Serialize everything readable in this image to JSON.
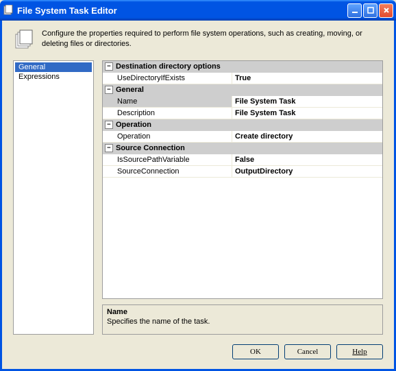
{
  "window": {
    "title": "File System Task Editor",
    "description": "Configure the properties required to perform file system operations, such as creating, moving, or deleting files or directories."
  },
  "sidebar": {
    "items": [
      {
        "label": "General",
        "selected": true
      },
      {
        "label": "Expressions",
        "selected": false
      }
    ]
  },
  "grid": {
    "categories": [
      {
        "label": "Destination directory options",
        "rows": [
          {
            "name": "UseDirectoryIfExists",
            "value": "True"
          }
        ]
      },
      {
        "label": "General",
        "rows": [
          {
            "name": "Name",
            "value": "File System Task",
            "selected": true
          },
          {
            "name": "Description",
            "value": "File System Task"
          }
        ]
      },
      {
        "label": "Operation",
        "rows": [
          {
            "name": "Operation",
            "value": "Create directory"
          }
        ]
      },
      {
        "label": "Source Connection",
        "rows": [
          {
            "name": "IsSourcePathVariable",
            "value": "False"
          },
          {
            "name": "SourceConnection",
            "value": "OutputDirectory"
          }
        ]
      }
    ]
  },
  "help": {
    "title": "Name",
    "description": "Specifies the name of the task."
  },
  "buttons": {
    "ok": "OK",
    "cancel": "Cancel",
    "help": "Help"
  }
}
